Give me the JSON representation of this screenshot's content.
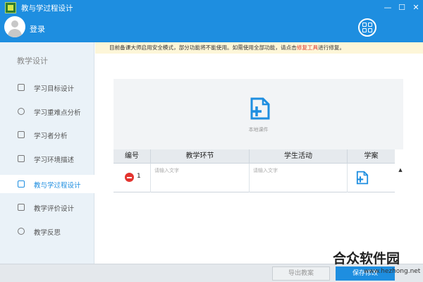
{
  "window": {
    "title": "教与学过程设计",
    "minimize": "—",
    "maximize": "☐",
    "close": "✕"
  },
  "header": {
    "login": "登录"
  },
  "sidebar": {
    "heading": "教学设计",
    "items": [
      {
        "label": "学习目标设计",
        "icon": "edit-icon"
      },
      {
        "label": "学习重难点分析",
        "icon": "star-icon"
      },
      {
        "label": "学习者分析",
        "icon": "chat-icon"
      },
      {
        "label": "学习环境描述",
        "icon": "home-icon"
      },
      {
        "label": "教与学过程设计",
        "icon": "list-icon",
        "active": true
      },
      {
        "label": "教学评价设计",
        "icon": "evaluation-icon"
      },
      {
        "label": "教学反思",
        "icon": "question-icon"
      }
    ]
  },
  "notice": {
    "text_before": "目前备课大师启用安全模式，部分功能将不能使用。如需使用全部功能，请点击",
    "link": "修复工具",
    "text_after": "进行修复。"
  },
  "upload": {
    "label": "本地课件"
  },
  "table": {
    "headers": [
      "编号",
      "教学环节",
      "学生活动",
      "学案"
    ],
    "rows": [
      {
        "num": "1",
        "step_placeholder": "请输入文字",
        "activity_placeholder": "请输入文字"
      }
    ]
  },
  "scroll": {
    "up": "▲"
  },
  "footer": {
    "export": "导出教案",
    "save": "保存修改"
  },
  "watermark": {
    "main": "合众软件园",
    "sub": "www.hezhong.net"
  },
  "colors": {
    "brand": "#1e8ee0",
    "danger": "#e3342f",
    "notice_bg": "#fdf6d8",
    "link": "#e03a2f"
  }
}
